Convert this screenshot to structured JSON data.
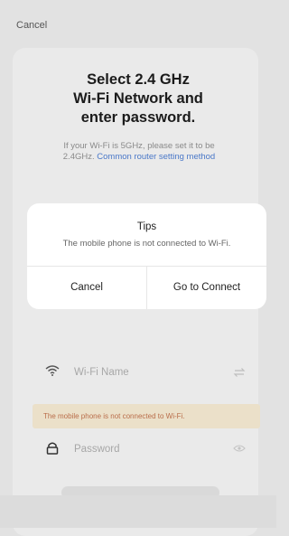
{
  "topbar": {
    "cancel_label": "Cancel"
  },
  "header": {
    "title_line1": "Select 2.4 GHz",
    "title_line2": "Wi-Fi Network and",
    "title_line3": "enter password.",
    "subtitle_text": "If your Wi-Fi is 5GHz, please set it to be 2.4GHz.",
    "subtitle_link": "Common router setting method"
  },
  "form": {
    "wifi_name_label": "Wi-Fi Name",
    "password_label": "Password",
    "warning": "The mobile phone is not connected to Wi-Fi."
  },
  "dialog": {
    "title": "Tips",
    "message": "The mobile phone is not connected to Wi-Fi.",
    "cancel_label": "Cancel",
    "confirm_label": "Go to Connect"
  },
  "icons": {
    "wifi": "wifi-icon",
    "switch": "switch-network-icon",
    "lock": "lock-icon",
    "eye": "eye-icon"
  },
  "colors": {
    "link": "#4a78c8",
    "warning_text": "#b96d4a",
    "warning_bg": "#ebe0c9"
  }
}
